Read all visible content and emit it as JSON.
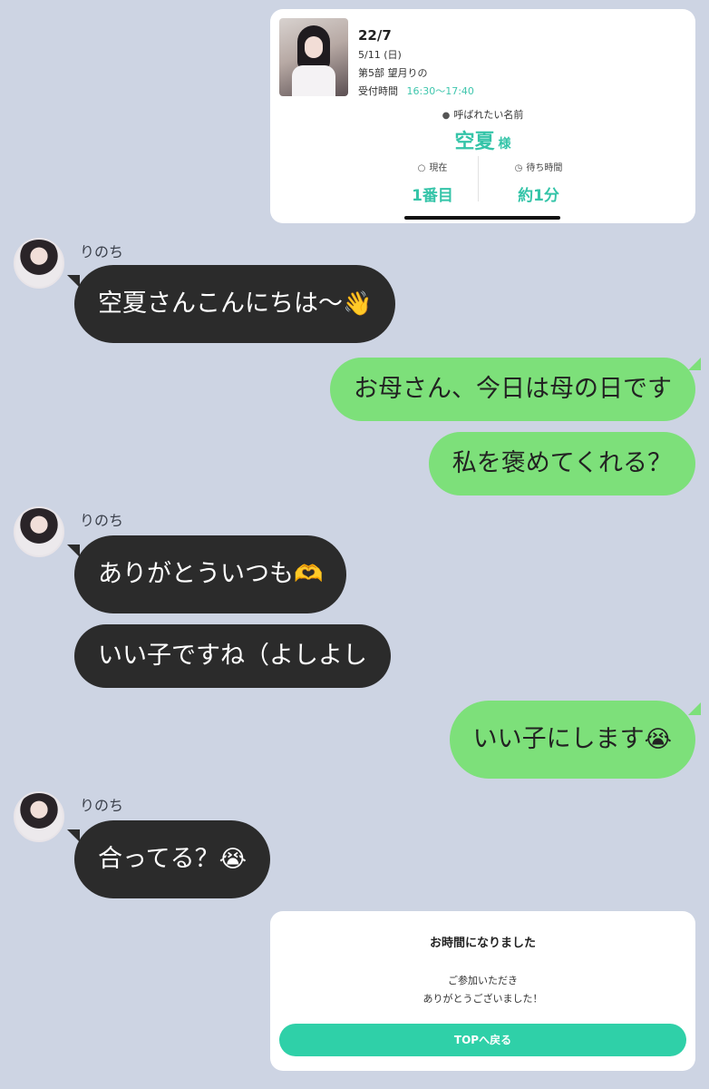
{
  "ticket": {
    "group": "22/7",
    "date": "5/11 (日)",
    "session": "第5部 望月りの",
    "reception_label": "受付時間",
    "reception_time": "16:30〜17:40",
    "name_label": "呼ばれたい名前",
    "name_value": "空夏",
    "name_suffix": "様",
    "current_label": "現在",
    "current_value": "1番目",
    "wait_label": "待ち時間",
    "wait_value": "約1分"
  },
  "messages": [
    {
      "sender": "りのち",
      "text": "空夏さんこんにちは〜",
      "emoji": "👋"
    },
    {
      "text": "お母さん、今日は母の日です"
    },
    {
      "text": "私を褒めてくれる？"
    },
    {
      "sender": "りのち",
      "text": "ありがとういつも",
      "emoji": "🫶"
    },
    {
      "text": "いい子ですね（よしよし"
    },
    {
      "text": "いい子にします",
      "emoji": "😭"
    },
    {
      "sender": "りのち",
      "text": "合ってる？",
      "emoji": "😭"
    }
  ],
  "end_card": {
    "title": "お時間になりました",
    "line1": "ご参加いただき",
    "line2": "ありがとうございました！",
    "button": "TOPへ戻る"
  },
  "colors": {
    "background": "#cdd4e3",
    "incoming_bubble": "#2b2b2b",
    "outgoing_bubble": "#7de07a",
    "accent": "#34c4a8",
    "button": "#2fd0a8"
  }
}
